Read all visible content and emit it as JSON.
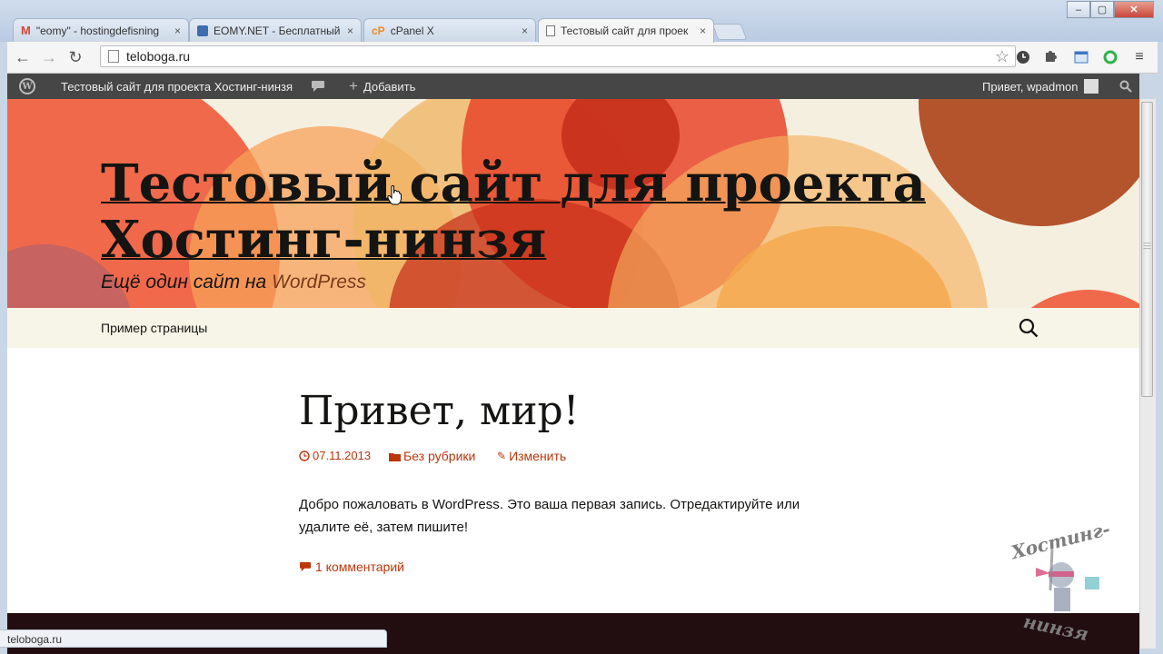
{
  "browser": {
    "tabs": [
      {
        "label": "\"eomy\" - hostingdefisning",
        "icon": "gmail-icon",
        "active": false
      },
      {
        "label": "EOMY.NET - Бесплатный",
        "icon": "eomy-icon",
        "active": false
      },
      {
        "label": "cPanel X",
        "icon": "cpanel-icon",
        "active": false
      },
      {
        "label": "Тестовый сайт для проек",
        "icon": "page-icon",
        "active": true
      }
    ],
    "close_glyph": "×",
    "url": "teloboga.ru",
    "status_text": "teloboga.ru",
    "window_controls": {
      "minimize": "–",
      "maximize": "▢",
      "close": "✕"
    }
  },
  "adminbar": {
    "site_name": "Тестовый сайт для проекта Хостинг-нинзя",
    "add_label": "Добавить",
    "greeting": "Привет, wpadmon"
  },
  "site": {
    "title": "Тестовый сайт для проекта Хостинг-нинзя",
    "description_prefix": "Ещё один сайт на ",
    "description_link": "WordPress",
    "nav_item": "Пример страницы"
  },
  "post": {
    "title": "Привет, мир!",
    "date": "07.11.2013",
    "category": "Без рубрики",
    "edit_label": "Изменить",
    "body": "Добро пожаловать в WordPress. Это ваша первая запись. Отредактируйте или удалите её, затем пишите!",
    "comments": "1 комментарий"
  },
  "watermark": {
    "top_text": "Хостинг-",
    "bottom_text": "нинзя"
  },
  "colors": {
    "accent": "#bc360a",
    "admin_bar": "#464646",
    "nav_bg": "#f7f5e7",
    "footer": "#220e10"
  }
}
